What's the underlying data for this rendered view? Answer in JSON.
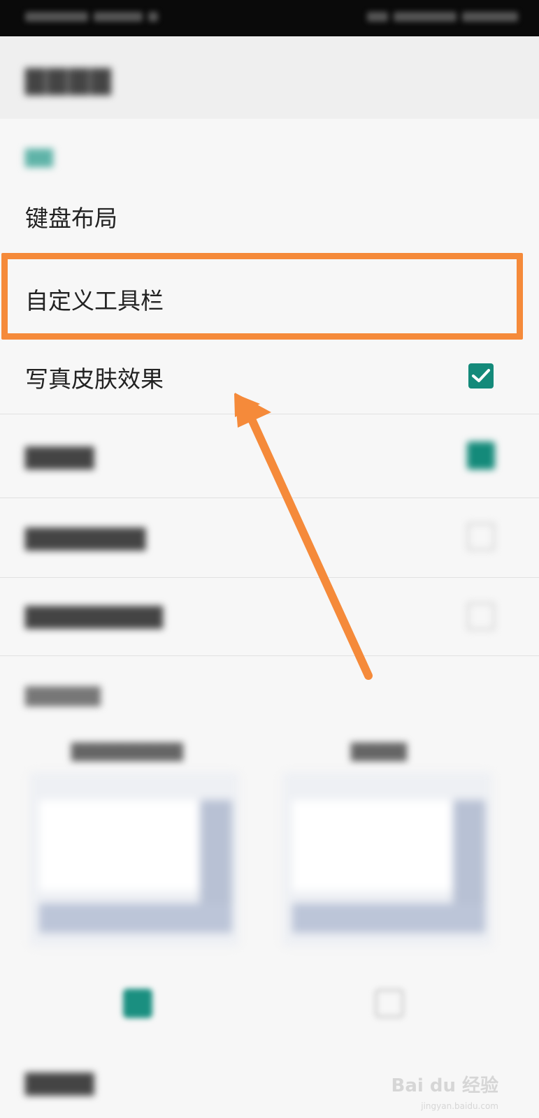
{
  "settings": {
    "items": [
      {
        "label": "键盘布局"
      },
      {
        "label": "自定义工具栏"
      },
      {
        "label": "写真皮肤效果",
        "checked": true
      }
    ]
  },
  "watermark": {
    "text": "Bai du 经验",
    "sub": "jingyan.baidu.com"
  },
  "colors": {
    "accent": "#148a7a",
    "highlight": "#f58a3a"
  }
}
